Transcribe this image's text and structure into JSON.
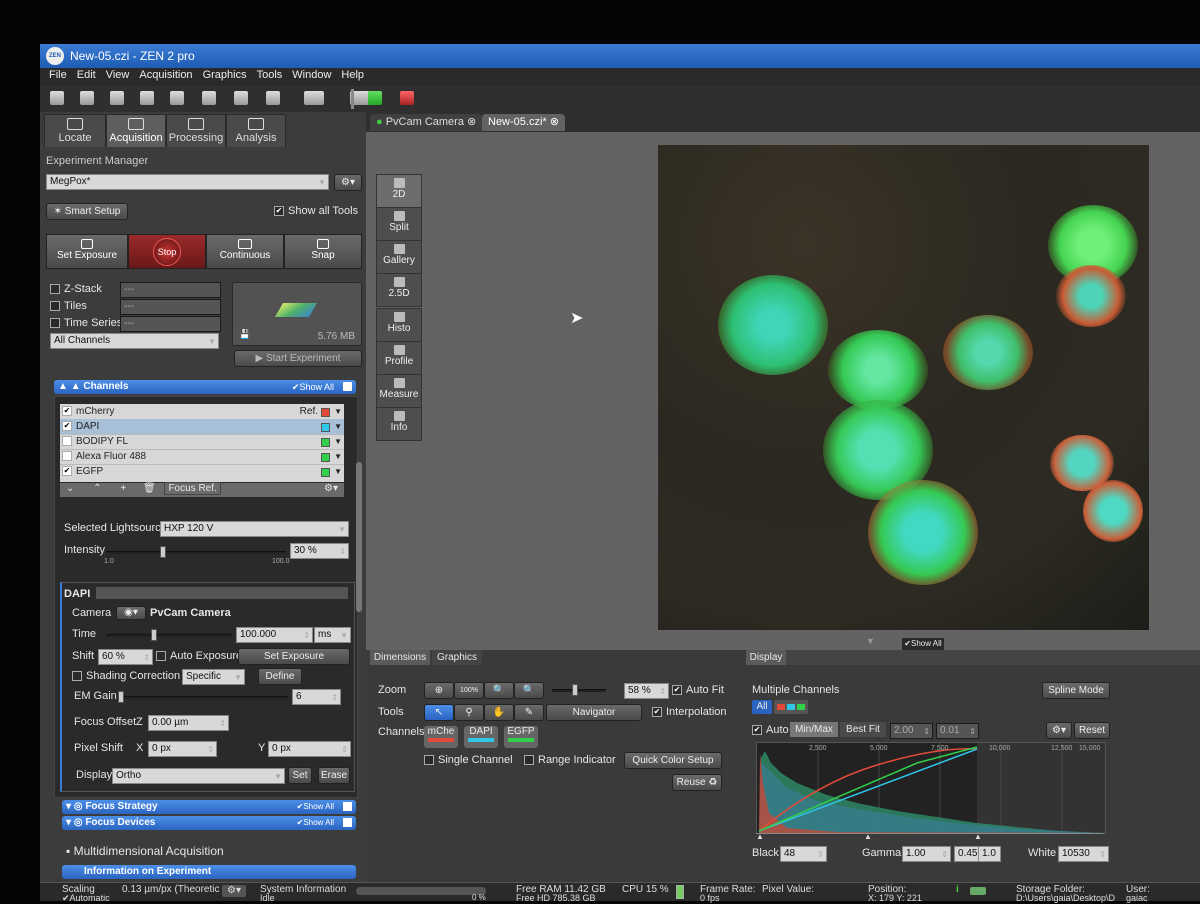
{
  "window": {
    "logo": "ZEN",
    "title": "New-05.czi - ZEN 2 pro"
  },
  "menu": [
    "File",
    "Edit",
    "View",
    "Acquisition",
    "Graphics",
    "Tools",
    "Window",
    "Help"
  ],
  "main_tabs": [
    {
      "label": "Locate",
      "icon": "camera-icon"
    },
    {
      "label": "Acquisition",
      "icon": "acquisition-icon"
    },
    {
      "label": "Processing",
      "icon": "gear-icon"
    },
    {
      "label": "Analysis",
      "icon": "bell-icon"
    }
  ],
  "experiment": {
    "manager_label": "Experiment Manager",
    "name": "MegPox*",
    "smart_setup": "Smart Setup",
    "show_all_tools": "Show all Tools",
    "buttons": {
      "set_exposure": "Set Exposure",
      "stop": "Stop",
      "continuous": "Continuous",
      "snap": "Snap"
    },
    "options": [
      {
        "label": "Z-Stack",
        "value": "---"
      },
      {
        "label": "Tiles",
        "value": "---"
      },
      {
        "label": "Time Series",
        "value": "---"
      }
    ],
    "channels_select": "All Channels",
    "file_size": "5.76 MB",
    "start": "Start Experiment"
  },
  "channels": {
    "header": "Channels",
    "show_all": "Show All",
    "ref_label": "Ref.",
    "list": [
      {
        "name": "mCherry",
        "checked": true,
        "color": "#e24b3a"
      },
      {
        "name": "DAPI",
        "checked": true,
        "color": "#2fc6e8"
      },
      {
        "name": "BODIPY FL",
        "checked": false,
        "color": "#31d04a"
      },
      {
        "name": "Alexa Fluor 488",
        "checked": false,
        "color": "#31d04a"
      },
      {
        "name": "EGFP",
        "checked": true,
        "color": "#31d04a"
      }
    ],
    "focus_ref": "Focus Ref.",
    "lightsource_label": "Selected Lightsource",
    "lightsource": "HXP 120 V",
    "intensity_label": "Intensity",
    "intensity": "30 %",
    "intensity_min": "1.0",
    "intensity_max": "100.0",
    "intensity_fraction": 0.3
  },
  "dapi": {
    "title": "DAPI",
    "camera_label": "Camera",
    "camera": "PvCam Camera",
    "time_label": "Time",
    "time": "100.000",
    "time_unit": "ms",
    "shift_label": "Shift",
    "shift": "60 %",
    "auto_exposure": "Auto Exposure",
    "set_exposure": "Set Exposure",
    "shading_label": "Shading Correction",
    "shading": "Specific",
    "define": "Define",
    "em_gain_label": "EM Gain",
    "em_gain": "6",
    "focus_offset_label": "Focus Offset",
    "focus_offset_axis": "Z",
    "focus_offset": "0.00 µm",
    "pixel_shift_label": "Pixel Shift",
    "px_x_axis": "X",
    "px_x": "0 px",
    "px_y_axis": "Y",
    "px_y": "0 px",
    "display_label": "Display",
    "display": "Ortho",
    "set": "Set",
    "erase": "Erase"
  },
  "collapsed_sections": [
    {
      "label": "Focus Strategy",
      "show_all": "Show All"
    },
    {
      "label": "Focus Devices",
      "show_all": "Show All"
    }
  ],
  "multidim": "Multidimensional Acquisition",
  "info_experiment": "Information on Experiment",
  "doc_tabs": [
    "PvCam Camera",
    "New-05.czi*"
  ],
  "view_tools": [
    "2D",
    "Split",
    "Gallery",
    "2.5D",
    "Histo",
    "Profile",
    "Measure",
    "Info"
  ],
  "show_all_small": "Show All",
  "dimensions": {
    "tabs": [
      "Dimensions",
      "Graphics"
    ],
    "zoom_label": "Zoom",
    "zoom_100": "100%",
    "zoom_value": "58 %",
    "auto_fit": "Auto Fit",
    "tools_label": "Tools",
    "navigator": "Navigator",
    "interpolation": "Interpolation",
    "channels_label": "Channels",
    "channel_chips": [
      {
        "name": "mChe",
        "color": "#e24b3a"
      },
      {
        "name": "DAPI",
        "color": "#2fc6e8"
      },
      {
        "name": "EGFP",
        "color": "#31d04a"
      }
    ],
    "single_channel": "Single Channel",
    "range_indicator": "Range Indicator",
    "quick_color": "Quick Color Setup",
    "reuse": "Reuse"
  },
  "display": {
    "tab": "Display",
    "title": "Multiple Channels",
    "spline_mode": "Spline Mode",
    "all": "All",
    "auto": "Auto",
    "minmax": "Min/Max",
    "best_fit": "Best Fit",
    "bf_val1": "2.00",
    "bf_val2": "0.01",
    "reset": "Reset",
    "hist_ticks": [
      "2,500",
      "5,000",
      "7,500",
      "10,000",
      "12,500",
      "15,000"
    ],
    "black_label": "Black",
    "black": "48",
    "gamma_label": "Gamma",
    "gamma": "1.00",
    "gamma2": "0.45",
    "gamma3": "1.0",
    "white_label": "White",
    "white": "10530"
  },
  "status": {
    "scaling_label": "Scaling",
    "scaling": "0.13 µm/px (Theoretic",
    "automatic": "Automatic",
    "sys_info": "System Information",
    "idle": "Idle",
    "free_ram": "Free RAM 11.42 GB",
    "free_hd": "Free HD   785.38 GB",
    "cpu": "CPU 15 %",
    "frame_rate_label": "Frame Rate:",
    "frame_rate": "0 fps",
    "pixel_value": "Pixel Value:",
    "position_label": "Position:",
    "position": "X: 179 Y: 221",
    "storage_label": "Storage Folder:",
    "storage": "D:\\Users\\gaia\\Desktop\\D",
    "user_label": "User:",
    "user": "gaiac",
    "percent": "0 %"
  }
}
